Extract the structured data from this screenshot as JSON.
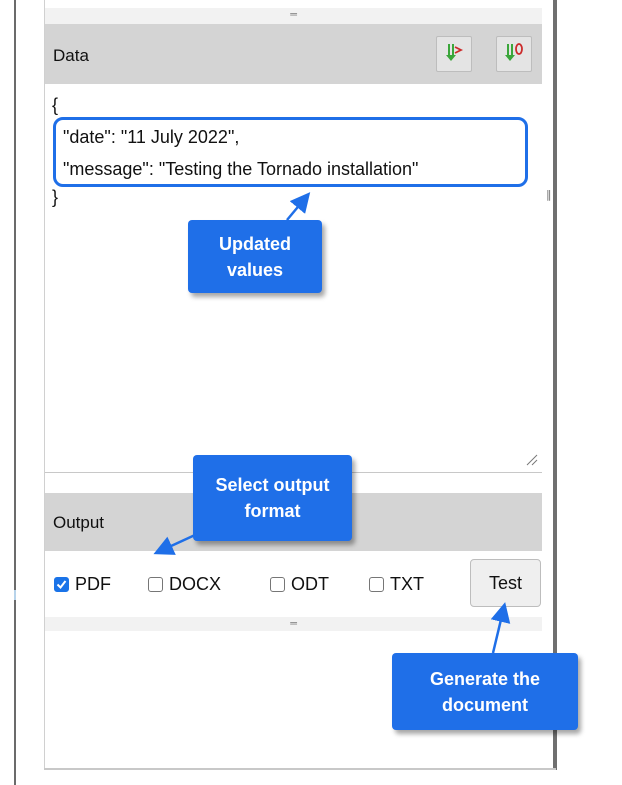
{
  "data_panel": {
    "title": "Data",
    "toolbar": [
      {
        "icon": "import-arrow-icon"
      },
      {
        "icon": "export-arrow-icon"
      }
    ],
    "json_lines": [
      "{",
      "\"date\": \"11 July 2022\",",
      "\"message\": \"Testing the Tornado installation\"",
      "}"
    ]
  },
  "output_panel": {
    "title": "Output",
    "formats": [
      {
        "label": "PDF",
        "checked": true
      },
      {
        "label": "DOCX",
        "checked": false
      },
      {
        "label": "ODT",
        "checked": false
      },
      {
        "label": "TXT",
        "checked": false
      }
    ],
    "test_button": "Test"
  },
  "grip_symbol": "═",
  "scroll_grip_symbol": "‖",
  "callouts": {
    "updated_values": "Updated\nvalues",
    "select_output": "Select output\nformat",
    "generate": "Generate the\ndocument"
  },
  "colors": {
    "accent": "#1f6fe8",
    "checkbox": "#1a73e8",
    "header_bg": "#d4d4d4",
    "icon_green": "#3aa63a",
    "icon_red": "#cc2b2b"
  }
}
